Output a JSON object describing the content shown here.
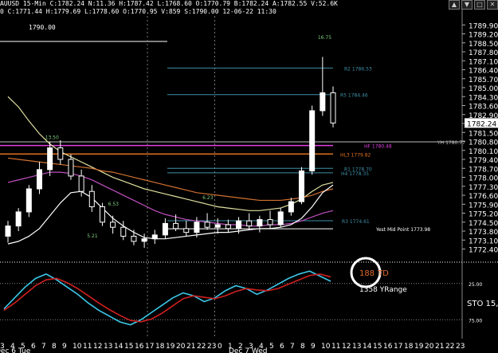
{
  "header": {
    "line1": "AUUSD 15-Min  C:1782.24  N:11.36  H:1787.42  L:1768.60  O:1770.79  B:1782.24  A:1782.55  V:52.6K",
    "line2": "0  C:1771.44  H:1779.69  L:1778.60  O:1770.95  V:859  S:1790.00  12-06-22 11:30",
    "line3": "1790.00"
  },
  "window_controls": [
    "▲",
    "▼",
    "□",
    "✕"
  ],
  "chart_data": {
    "type": "candlestick",
    "symbol": "AUUSD",
    "timeframe": "15-Min",
    "price_axis": {
      "ylim": [
        1771.5,
        1790.6
      ],
      "ticks": [
        "1789.90",
        "1789.20",
        "1788.50",
        "1787.80",
        "1787.10",
        "1786.40",
        "1785.70",
        "1785.00",
        "1784.30",
        "1783.60",
        "1782.90",
        "1782.20",
        "1781.50",
        "1780.80",
        "1780.10",
        "1779.40",
        "1778.70",
        "1778.00",
        "1777.30",
        "1776.60",
        "1775.90",
        "1775.20",
        "1774.50",
        "1773.80",
        "1773.10",
        "1772.40"
      ],
      "current_price": "1782.24"
    },
    "time_axis": {
      "ticks": [
        "3",
        "4",
        "5",
        "6",
        "7",
        "8",
        "9",
        "10",
        "11",
        "12",
        "13",
        "14",
        "15",
        "16",
        "17",
        "18",
        "19",
        "20",
        "21",
        "22",
        "23",
        "0",
        "1",
        "2",
        "3",
        "4",
        "5",
        "6",
        "7",
        "8",
        "9",
        "10",
        "11",
        "12",
        "13",
        "14",
        "15",
        "16",
        "17",
        "18",
        "19",
        "20",
        "21",
        "22",
        "23"
      ],
      "session_labels": [
        "Dec 6 Tue",
        "Dec 7 Wed"
      ]
    },
    "levels": [
      {
        "label": "R2 1786.53",
        "value": 1786.53,
        "color": "#3f8fa8"
      },
      {
        "label": "R5 1784.46",
        "value": 1784.46,
        "color": "#3f8fa8"
      },
      {
        "label": "YH 1780.77",
        "value": 1780.77,
        "color": "#bbbbbb"
      },
      {
        "label": "HF 1780.48",
        "value": 1780.48,
        "color": "#e040e0"
      },
      {
        "label": "HL3 1779.82",
        "value": 1779.82,
        "color": "#e07020"
      },
      {
        "label": "R1 1778.70",
        "value": 1778.7,
        "color": "#3f8fa8"
      },
      {
        "label": "H4 1778.35",
        "value": 1778.35,
        "color": "#3f8fa8"
      },
      {
        "label": "R3 1774.61",
        "value": 1774.61,
        "color": "#3f8fa8"
      },
      {
        "label": "Yest Mid Point 1773.98",
        "value": 1773.98,
        "color": "#ffffff"
      }
    ],
    "candle_labels": [
      "13.50",
      "6.53",
      "6.23",
      "5.21",
      "16.75"
    ],
    "candles": [
      [
        1773.4,
        1774.6,
        1772.9,
        1774.2
      ],
      [
        1774.2,
        1775.6,
        1773.8,
        1775.3
      ],
      [
        1775.3,
        1777.4,
        1774.9,
        1777.1
      ],
      [
        1777.1,
        1779.2,
        1776.7,
        1778.6
      ],
      [
        1778.6,
        1780.8,
        1778.1,
        1780.3
      ],
      [
        1780.3,
        1780.9,
        1779.0,
        1779.4
      ],
      [
        1779.4,
        1779.8,
        1777.8,
        1778.1
      ],
      [
        1778.1,
        1778.6,
        1776.5,
        1776.9
      ],
      [
        1776.9,
        1777.4,
        1775.3,
        1775.7
      ],
      [
        1775.7,
        1776.0,
        1774.2,
        1774.5
      ],
      [
        1774.5,
        1775.0,
        1773.6,
        1774.1
      ],
      [
        1774.1,
        1774.6,
        1773.1,
        1773.4
      ],
      [
        1773.4,
        1773.9,
        1772.7,
        1773.0
      ],
      [
        1773.0,
        1773.6,
        1772.5,
        1773.2
      ],
      [
        1773.2,
        1773.9,
        1772.8,
        1773.5
      ],
      [
        1773.5,
        1774.8,
        1773.2,
        1774.4
      ],
      [
        1774.4,
        1775.1,
        1773.8,
        1774.0
      ],
      [
        1774.0,
        1774.6,
        1773.4,
        1773.7
      ],
      [
        1773.7,
        1774.9,
        1773.3,
        1774.5
      ],
      [
        1774.5,
        1775.2,
        1773.9,
        1774.1
      ],
      [
        1774.1,
        1774.8,
        1773.6,
        1774.3
      ],
      [
        1774.3,
        1774.7,
        1773.7,
        1774.0
      ],
      [
        1774.0,
        1774.9,
        1773.6,
        1774.6
      ],
      [
        1774.6,
        1775.2,
        1773.9,
        1774.2
      ],
      [
        1774.2,
        1775.0,
        1773.7,
        1774.7
      ],
      [
        1774.7,
        1775.4,
        1774.0,
        1774.3
      ],
      [
        1774.3,
        1775.6,
        1774.1,
        1775.3
      ],
      [
        1775.3,
        1776.4,
        1775.0,
        1776.1
      ],
      [
        1776.1,
        1778.8,
        1775.9,
        1778.5
      ],
      [
        1778.5,
        1783.6,
        1778.2,
        1783.2
      ],
      [
        1783.2,
        1787.4,
        1782.8,
        1784.6
      ],
      [
        1784.6,
        1785.1,
        1781.9,
        1782.24
      ]
    ],
    "moving_averages": [
      {
        "name": "",
        "color": "#e0e0a0",
        "values": [
          1784.3,
          1783.5,
          1782.4,
          1781.4,
          1780.6,
          1780.0,
          1779.6,
          1779.2,
          1778.8,
          1778.4,
          1778.0,
          1777.7,
          1777.4,
          1777.1,
          1776.9,
          1776.7,
          1776.5,
          1776.3,
          1776.1,
          1775.9,
          1775.7,
          1775.6,
          1775.5,
          1775.4,
          1775.4,
          1775.5,
          1775.6,
          1775.9,
          1776.3,
          1776.9,
          1777.4,
          1777.6
        ]
      },
      {
        "name": "",
        "color": "#d07030",
        "values": [
          1779.5,
          1779.4,
          1779.3,
          1779.2,
          1779.1,
          1779.0,
          1778.9,
          1778.8,
          1778.7,
          1778.5,
          1778.4,
          1778.2,
          1778.0,
          1777.8,
          1777.6,
          1777.4,
          1777.2,
          1777.0,
          1776.8,
          1776.7,
          1776.6,
          1776.5,
          1776.4,
          1776.3,
          1776.2,
          1776.2,
          1776.2,
          1776.3,
          1776.4,
          1776.6,
          1776.9,
          1777.1
        ]
      },
      {
        "name": "",
        "color": "#c050c0",
        "values": [
          1777.6,
          1777.8,
          1778.0,
          1778.2,
          1778.4,
          1778.4,
          1778.3,
          1778.1,
          1777.8,
          1777.4,
          1777.0,
          1776.6,
          1776.2,
          1775.8,
          1775.4,
          1775.1,
          1774.9,
          1774.7,
          1774.6,
          1774.5,
          1774.4,
          1774.3,
          1774.3,
          1774.2,
          1774.2,
          1774.3,
          1774.3,
          1774.4,
          1774.6,
          1774.9,
          1775.2,
          1775.4
        ]
      },
      {
        "name": "",
        "color": "#ffffff",
        "values": [
          1772.8,
          1773.0,
          1773.4,
          1774.0,
          1775.0,
          1776.0,
          1776.8,
          1776.9,
          1776.4,
          1775.6,
          1774.8,
          1774.2,
          1773.7,
          1773.3,
          1773.2,
          1773.2,
          1773.3,
          1773.4,
          1773.5,
          1773.6,
          1773.7,
          1773.7,
          1773.8,
          1773.9,
          1774.0,
          1774.0,
          1774.1,
          1774.3,
          1774.8,
          1775.7,
          1776.8,
          1777.4
        ]
      }
    ],
    "indicator": {
      "name": "STO",
      "label": "STO  15,",
      "ticks": [
        "25.00",
        "75.00"
      ],
      "levels": [
        25,
        75
      ],
      "ylim": [
        0,
        100
      ],
      "k_values": [
        40,
        55,
        70,
        82,
        88,
        80,
        70,
        60,
        48,
        38,
        30,
        22,
        18,
        25,
        35,
        45,
        55,
        62,
        58,
        50,
        55,
        65,
        72,
        68,
        60,
        66,
        74,
        82,
        88,
        92,
        85,
        78
      ],
      "d_values": [
        38,
        48,
        60,
        72,
        80,
        82,
        76,
        68,
        58,
        48,
        39,
        31,
        24,
        22,
        26,
        34,
        44,
        54,
        58,
        56,
        54,
        58,
        64,
        68,
        66,
        65,
        68,
        74,
        80,
        86,
        88,
        84
      ]
    },
    "annotations": {
      "td_value": "188",
      "td_label": "TD",
      "yrange": "1358 YRange"
    }
  }
}
